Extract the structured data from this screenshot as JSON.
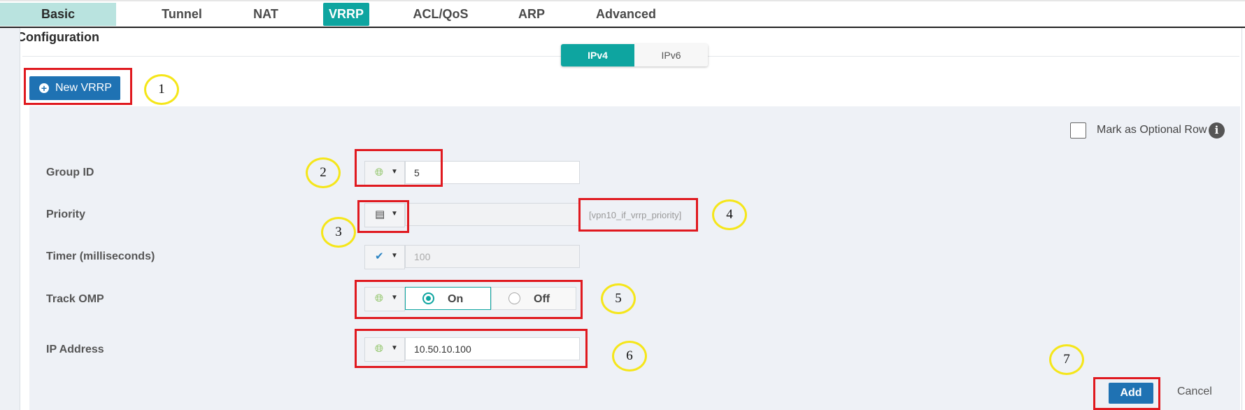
{
  "nav": {
    "tabs": [
      {
        "label": "Basic Configuration"
      },
      {
        "label": "Tunnel"
      },
      {
        "label": "NAT"
      },
      {
        "label": "VRRP"
      },
      {
        "label": "ACL/QoS"
      },
      {
        "label": "ARP"
      },
      {
        "label": "Advanced"
      }
    ],
    "active_tab": "VRRP"
  },
  "ip_toggle": {
    "ipv4": "IPv4",
    "ipv6": "IPv6",
    "selected": "IPv4"
  },
  "new_button": {
    "label": "New VRRP",
    "icon": "plus-circle-icon"
  },
  "optional_row": {
    "label": "Mark as Optional Row",
    "checked": false,
    "icon": "info-icon"
  },
  "form": {
    "group_id": {
      "label": "Group ID",
      "scope_icon": "globe-icon",
      "value": "5"
    },
    "priority": {
      "label": "Priority",
      "scope_icon": "device-icon",
      "value": "",
      "variable": "[vpn10_if_vrrp_priority]"
    },
    "timer": {
      "label": "Timer (milliseconds)",
      "scope_icon": "check-icon",
      "value": "100"
    },
    "track_omp": {
      "label": "Track OMP",
      "scope_icon": "globe-icon",
      "on_label": "On",
      "off_label": "Off",
      "selected": "On"
    },
    "ip_address": {
      "label": "IP Address",
      "scope_icon": "globe-icon",
      "value": "10.50.10.100"
    }
  },
  "actions": {
    "add": "Add",
    "cancel": "Cancel"
  },
  "callouts": [
    "1",
    "2",
    "3",
    "4",
    "5",
    "6",
    "7"
  ],
  "colors": {
    "accent": "#0ea5a0",
    "button_blue": "#1f72b3",
    "highlight_red": "#e0191f",
    "callout_yellow": "#f5e61a"
  }
}
